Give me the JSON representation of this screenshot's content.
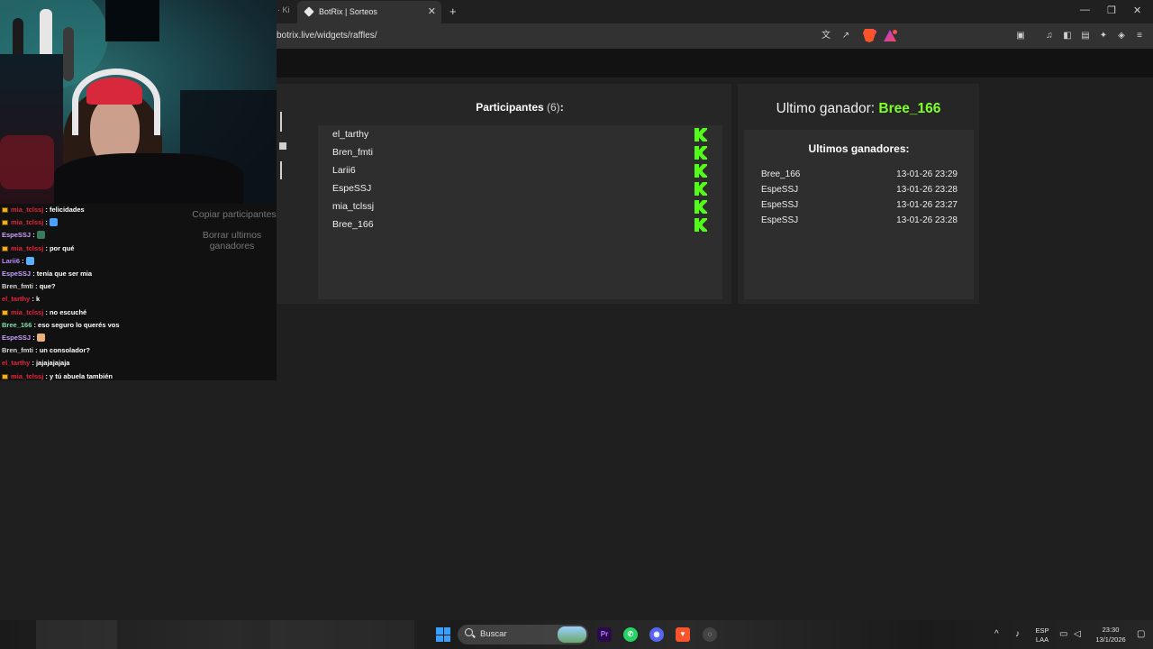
{
  "browser": {
    "prev_tab_fragment": "· Ki",
    "active_tab_title": "BotRix | Sorteos",
    "url": "botrix.live/widgets/raffles/",
    "new_tab_symbol": "+",
    "tab_close_symbol": "✕",
    "window_controls": {
      "minimize": "—",
      "restore": "❐",
      "close": "✕"
    }
  },
  "raffle": {
    "participants_label": "Participantes",
    "participants_count": "(6)",
    "participants_suffix": ":",
    "participants": [
      {
        "name": "el_tarthy"
      },
      {
        "name": "Bren_fmti"
      },
      {
        "name": "Larii6"
      },
      {
        "name": "EspeSSJ"
      },
      {
        "name": "mia_tclssj"
      },
      {
        "name": "Bree_166"
      }
    ],
    "last_winner_label": "Ultimo ganador:",
    "last_winner_name": "Bree_166",
    "winners_title": "Ultimos ganadores:",
    "winners": [
      {
        "name": "Bree_166",
        "time": "13-01-26 23:29"
      },
      {
        "name": "EspeSSJ",
        "time": "13-01-26 23:28"
      },
      {
        "name": "EspeSSJ",
        "time": "13-01-26 23:27"
      },
      {
        "name": "EspeSSJ",
        "time": "13-01-26 23:28"
      }
    ],
    "copy_button": "Copiar participantes",
    "clear_button": "Borrar ultimos ganadores"
  },
  "chat": [
    {
      "user": "mia_tclssj",
      "color": "#e8243c",
      "badge": true,
      "msg": "felicidades",
      "emoji": null
    },
    {
      "user": "mia_tclssj",
      "color": "#e8243c",
      "badge": true,
      "msg": "",
      "emoji": "#4aa0ff"
    },
    {
      "user": "EspeSSJ",
      "color": "#c9a0ff",
      "badge": false,
      "msg": "",
      "emoji": "#3a7a5a"
    },
    {
      "user": "mia_tclssj",
      "color": "#e8243c",
      "badge": true,
      "msg": "por qué",
      "emoji": null
    },
    {
      "user": "Larii6",
      "color": "#b98cff",
      "badge": false,
      "msg": "",
      "emoji": "#5ab0ff"
    },
    {
      "user": "EspeSSJ",
      "color": "#c9a0ff",
      "badge": false,
      "msg": "tenía que ser mia",
      "emoji": null
    },
    {
      "user": "Bren_fmti",
      "color": "#d8d8d8",
      "badge": false,
      "msg": "que?",
      "emoji": null
    },
    {
      "user": "el_tarthy",
      "color": "#e8243c",
      "badge": false,
      "msg": "k",
      "emoji": null
    },
    {
      "user": "mia_tclssj",
      "color": "#e8243c",
      "badge": true,
      "msg": "no escuché",
      "emoji": null
    },
    {
      "user": "Bree_166",
      "color": "#7fe0a8",
      "badge": false,
      "msg": "eso seguro lo querés vos",
      "emoji": null
    },
    {
      "user": "EspeSSJ",
      "color": "#c9a0ff",
      "badge": false,
      "msg": "",
      "emoji": "#e8b07a"
    },
    {
      "user": "Bren_fmti",
      "color": "#d8d8d8",
      "badge": false,
      "msg": "un consolador?",
      "emoji": null
    },
    {
      "user": "el_tarthy",
      "color": "#e8243c",
      "badge": false,
      "msg": "jajajajajaja",
      "emoji": null
    },
    {
      "user": "mia_tclssj",
      "color": "#e8243c",
      "badge": true,
      "msg": "y tú abuela también",
      "emoji": null
    }
  ],
  "taskbar": {
    "search_placeholder": "Buscar",
    "lang_top": "ESP",
    "lang_bottom": "LAA",
    "time": "23:30",
    "date": "13/1/2026"
  },
  "colors": {
    "kick_green": "#53fc18",
    "winner_green": "#7fff2a",
    "panel_bg": "#262626",
    "list_bg": "#2e2e2e"
  }
}
